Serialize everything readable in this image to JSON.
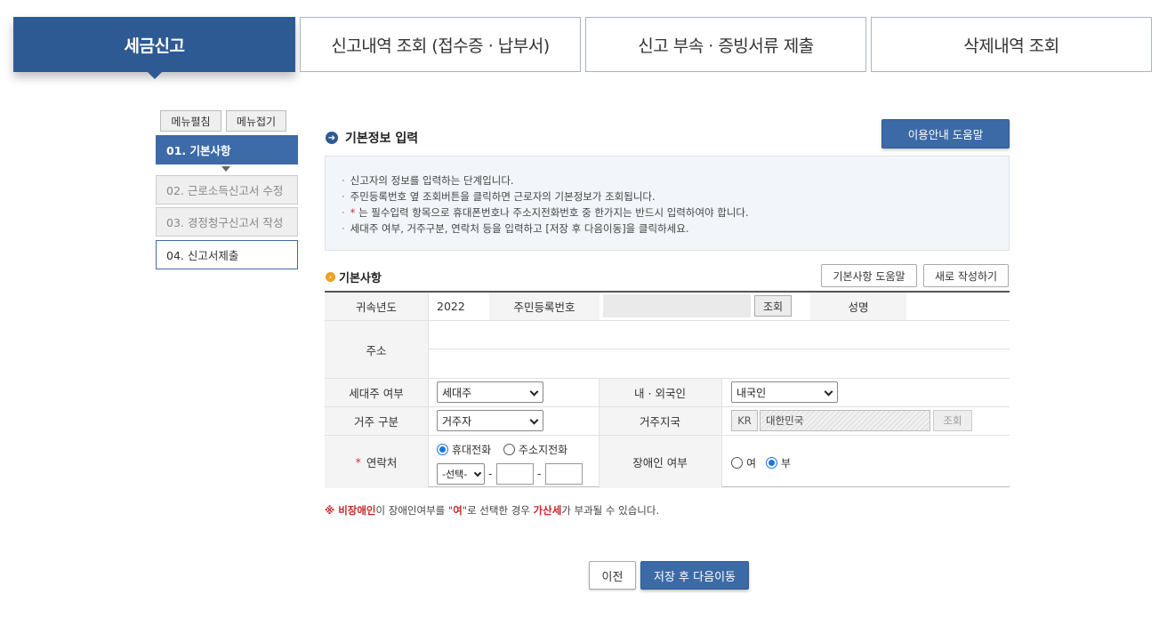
{
  "tabs": [
    {
      "label": "세금신고"
    },
    {
      "label": "신고내역 조회 (접수증 · 납부서)"
    },
    {
      "label": "신고 부속 · 증빙서류 제출"
    },
    {
      "label": "삭제내역 조회"
    }
  ],
  "sidebar": {
    "expand_label": "메뉴펼침",
    "collapse_label": "메뉴접기",
    "steps": [
      {
        "label": "01. 기본사항"
      },
      {
        "label": "02. 근로소득신고서 수정"
      },
      {
        "label": "03. 경정청구신고서 작성"
      },
      {
        "label": "04. 신고서제출"
      }
    ]
  },
  "main": {
    "title": "기본정보 입력",
    "help_button": "이용안내 도움말",
    "info": [
      "신고자의 정보를 입력하는 단계입니다.",
      "주민등록번호 옆 조회버튼을 클릭하면 근로자의 기본정보가 조회됩니다.",
      "는 필수입력 항목으로 휴대폰번호나 주소지전화번호 중 한가지는 반드시 입력하여야 합니다.",
      "세대주 여부, 거주구분, 연락처 등을 입력하고 [저장 후 다음이동]을 클릭하세요."
    ],
    "required_mark": "*",
    "section": "기본사항",
    "section_help": "기본사항 도움말",
    "new_button": "새로 작성하기"
  },
  "form": {
    "year_label": "귀속년도",
    "year_value": "2022",
    "rrn_label": "주민등록번호",
    "lookup": "조회",
    "name_label": "성명",
    "address_label": "주소",
    "householder_label": "세대주 여부",
    "householder_value": "세대주",
    "domestic_label": "내 · 외국인",
    "domestic_value": "내국인",
    "residence_label": "거주 구분",
    "residence_value": "거주자",
    "country_label": "거주지국",
    "country_code": "KR",
    "country_name": "대한민국",
    "country_lookup": "조회",
    "contact_label": "연락처",
    "contact_req": "*",
    "mobile_label": "휴대전화",
    "home_label": "주소지전화",
    "phone_select": "-선택-",
    "dash": "-",
    "disabled_label": "장애인 여부",
    "yes_label": "여",
    "no_label": "부"
  },
  "note": {
    "prefix": "※ ",
    "term": "비장애인",
    "mid1": "이 장애인여부를 \"",
    "yes": "여",
    "mid2": "\"로 선택한 경우 ",
    "penalty": "가산세",
    "suffix": "가 부과될 수 있습니다."
  },
  "buttons": {
    "prev": "이전",
    "next": "저장 후 다음이동"
  },
  "colors": {
    "primary": "#2e5a94",
    "accent": "#3c6aa7",
    "required": "#d32f2f"
  }
}
